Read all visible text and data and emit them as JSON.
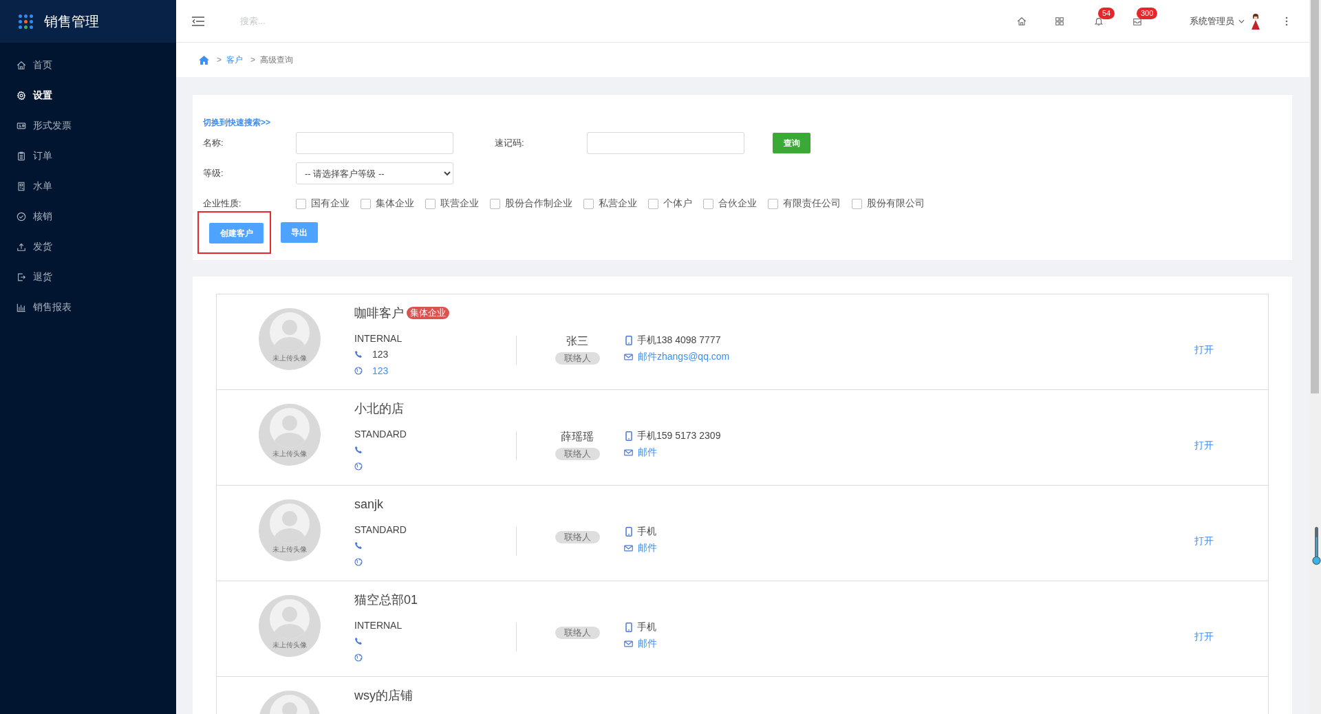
{
  "sidebar": {
    "title": "销售管理",
    "items": [
      {
        "label": "首页",
        "selected": false
      },
      {
        "label": "设置",
        "selected": true
      },
      {
        "label": "形式发票",
        "selected": false
      },
      {
        "label": "订单",
        "selected": false
      },
      {
        "label": "水单",
        "selected": false
      },
      {
        "label": "核销",
        "selected": false
      },
      {
        "label": "发货",
        "selected": false
      },
      {
        "label": "退货",
        "selected": false
      },
      {
        "label": "销售报表",
        "selected": false
      }
    ]
  },
  "header": {
    "search": {
      "placeholder": "搜索..."
    },
    "notifications_badge": "54",
    "messages_badge": "300",
    "user": "系统管理员"
  },
  "breadcrumb": [
    {
      "separator": ">",
      "label": "客户",
      "link": true
    },
    {
      "separator": ">",
      "label": "高级查询",
      "link": false
    }
  ],
  "search_form": {
    "switch_link": "切换到快速搜索>>",
    "fields": [
      {
        "label": "名称:"
      },
      {
        "label": "速记码:"
      }
    ],
    "query_button": "查询",
    "level": {
      "label": "等级:",
      "value": "-- 请选择客户等级 --"
    },
    "nature": {
      "label": "企业性质:",
      "options": [
        {
          "label": "国有企业",
          "checked": false
        },
        {
          "label": "集体企业",
          "checked": false
        },
        {
          "label": "联营企业",
          "checked": false
        },
        {
          "label": "股份合作制企业",
          "checked": false
        },
        {
          "label": "私营企业",
          "checked": false
        },
        {
          "label": "个体户",
          "checked": false
        },
        {
          "label": "合伙企业",
          "checked": false
        },
        {
          "label": "有限责任公司",
          "checked": false
        },
        {
          "label": "股份有限公司",
          "checked": false
        }
      ]
    },
    "actions": [
      {
        "label": "创建客户",
        "highlighted": true
      },
      {
        "label": "导出",
        "highlighted": false
      }
    ]
  },
  "customers": [
    {
      "name": "咖啡客户",
      "tag": "集体企业",
      "avatar_caption": "未上传头像",
      "level": "INTERNAL",
      "phone": "123",
      "website": "123",
      "contact": "张三",
      "contact_role": "联络人",
      "mobile": "手机138 4098 7777",
      "email": "邮件zhangs@qq.com",
      "action": "打开"
    },
    {
      "name": "小北的店",
      "avatar_caption": "未上传头像",
      "level": "STANDARD",
      "contact": "薛瑶瑶",
      "contact_role": "联络人",
      "mobile": "手机159 5173 2309",
      "email": "邮件",
      "action": "打开"
    },
    {
      "name": "sanjk",
      "avatar_caption": "未上传头像",
      "level": "STANDARD",
      "contact_role": "联络人",
      "mobile": "手机",
      "email": "邮件",
      "action": "打开"
    },
    {
      "name": "猫空总部01",
      "avatar_caption": "未上传头像",
      "level": "INTERNAL",
      "contact_role": "联络人",
      "mobile": "手机",
      "email": "邮件",
      "action": "打开"
    },
    {
      "name": "wsy的店铺"
    }
  ]
}
